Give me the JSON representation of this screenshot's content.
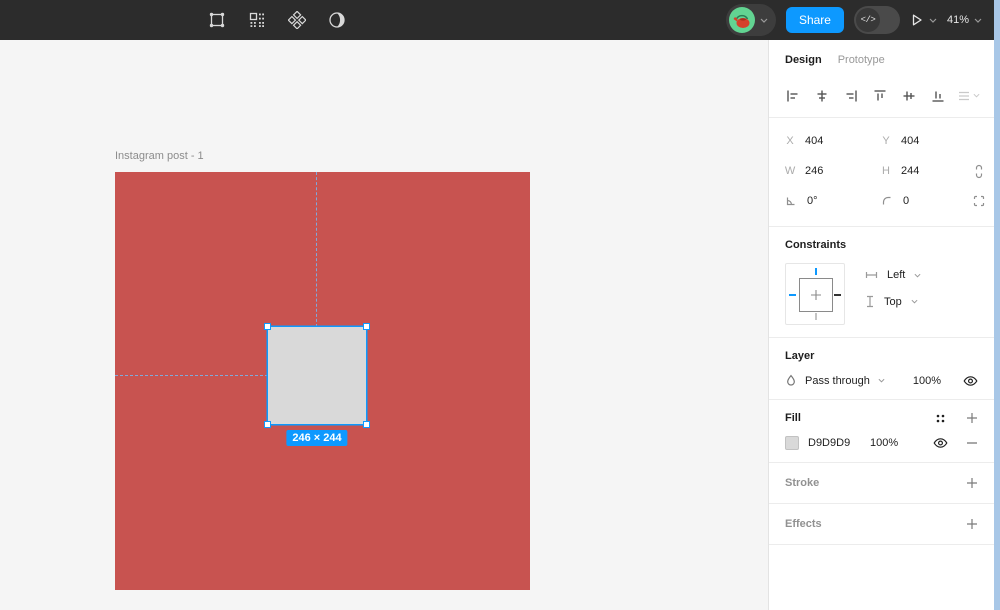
{
  "toolbar": {
    "icons": [
      "edit-object-icon",
      "layout-grid-icon",
      "components-icon",
      "mask-icon"
    ],
    "share_label": "Share",
    "dev_toggle_glyph": "</>",
    "zoom_level": "41%"
  },
  "canvas": {
    "frame_label": "Instagram post - 1",
    "frame_color": "#C85350",
    "background": "#F5F5F5",
    "selection": {
      "size_label": "246 × 244",
      "fill": "#D9D9D9",
      "accent": "#0D99FF"
    }
  },
  "panel": {
    "tabs": [
      "Design",
      "Prototype"
    ],
    "active_tab": "Design",
    "align_icons": [
      "align-left-icon",
      "align-h-center-icon",
      "align-right-icon",
      "align-top-icon",
      "align-v-center-icon",
      "align-bottom-icon",
      "distribute-icon"
    ],
    "transform": {
      "x_label": "X",
      "x": "404",
      "y_label": "Y",
      "y": "404",
      "w_label": "W",
      "w": "246",
      "h_label": "H",
      "h": "244",
      "rotation": "0°",
      "radius": "0"
    },
    "constraints": {
      "title": "Constraints",
      "horizontal": "Left",
      "vertical": "Top"
    },
    "layer": {
      "title": "Layer",
      "blend_mode": "Pass through",
      "opacity": "100%"
    },
    "fill": {
      "title": "Fill",
      "color_hex": "D9D9D9",
      "opacity": "100%",
      "swatch": "#D9D9D9"
    },
    "stroke": {
      "title": "Stroke"
    },
    "effects": {
      "title": "Effects"
    }
  },
  "colors": {
    "toolbar_bg": "#2C2C2C",
    "accent_blue": "#0D99FF",
    "edge_strip": "#A8C7E7"
  }
}
